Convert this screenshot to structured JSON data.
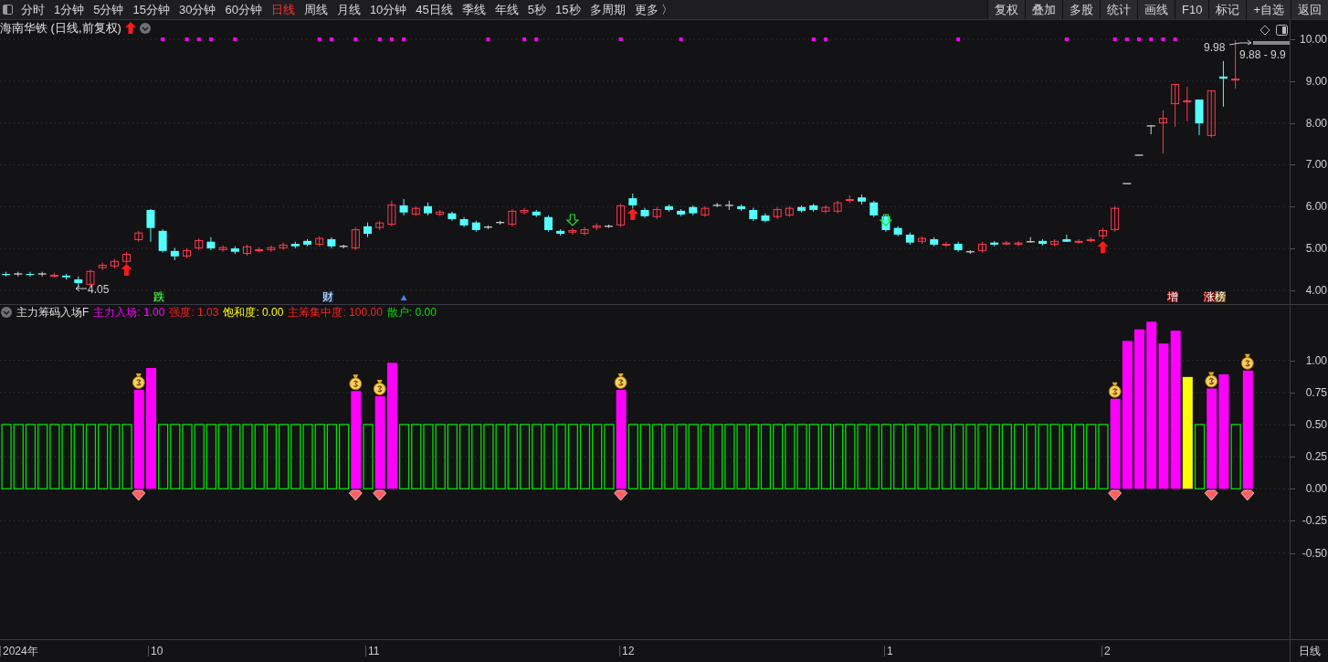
{
  "toolbar": {
    "periods": [
      {
        "label": "分时",
        "selected": false
      },
      {
        "label": "1分钟",
        "selected": false
      },
      {
        "label": "5分钟",
        "selected": false
      },
      {
        "label": "15分钟",
        "selected": false
      },
      {
        "label": "30分钟",
        "selected": false
      },
      {
        "label": "60分钟",
        "selected": false
      },
      {
        "label": "日线",
        "selected": true
      },
      {
        "label": "周线",
        "selected": false
      },
      {
        "label": "月线",
        "selected": false
      },
      {
        "label": "10分钟",
        "selected": false
      },
      {
        "label": "45日线",
        "selected": false
      },
      {
        "label": "季线",
        "selected": false
      },
      {
        "label": "年线",
        "selected": false
      },
      {
        "label": "5秒",
        "selected": false
      },
      {
        "label": "15秒",
        "selected": false
      },
      {
        "label": "多周期",
        "selected": false
      }
    ],
    "more": "更多 〉",
    "tools": [
      "复权",
      "叠加",
      "多股",
      "统计",
      "画线",
      "F10",
      "标记",
      "+自选",
      "返回"
    ]
  },
  "price_chart": {
    "title": "海南华铁 (日线,前复权)",
    "low_label": "4.05",
    "high_label": "9.98",
    "range_label": "9.88 - 9.9",
    "markers": [
      {
        "text": "跌",
        "kind": "fall"
      },
      {
        "text": "财",
        "kind": "finance"
      },
      {
        "text": "增",
        "kind": "increase"
      },
      {
        "text": "涨",
        "kind": "rise"
      },
      {
        "text": "榜",
        "kind": "list"
      }
    ],
    "chart_data": {
      "type": "candlestick",
      "grid": true,
      "ylim": [
        3.67,
        10.46
      ],
      "categories": [
        null,
        null,
        null,
        null,
        null,
        null,
        null,
        null,
        null,
        null,
        null,
        null,
        null,
        null,
        null,
        null,
        null,
        null,
        null,
        null,
        null,
        null,
        null,
        null,
        null,
        null,
        null,
        null,
        null,
        null,
        null,
        null,
        null,
        null,
        null,
        null,
        null,
        null,
        null,
        null,
        null,
        null,
        null,
        null,
        null,
        null,
        null,
        null,
        null,
        null,
        null,
        null,
        null,
        null,
        null,
        null,
        null,
        null,
        null,
        null,
        null,
        null,
        null,
        null,
        null,
        null,
        null,
        null,
        null,
        null,
        null,
        null,
        null,
        null,
        null,
        null,
        null,
        null,
        null,
        null,
        null,
        null,
        null,
        null,
        null,
        null,
        null,
        null,
        null,
        null,
        null,
        null,
        null,
        null,
        null,
        null,
        null,
        null,
        null,
        null,
        null,
        null,
        null,
        null,
        null,
        null,
        null
      ],
      "yticks": [
        {
          "value": 10,
          "label": "10.00"
        },
        {
          "value": 9,
          "label": "9.00"
        },
        {
          "value": 8,
          "label": "8.00"
        },
        {
          "value": 7,
          "label": "7.00"
        },
        {
          "value": 6,
          "label": "6.00"
        },
        {
          "value": 5,
          "label": "5.00"
        },
        {
          "value": 4,
          "label": "4.00"
        }
      ],
      "ohlc": [
        [
          4.39,
          4.44,
          4.33,
          4.37
        ],
        [
          4.39,
          4.44,
          4.33,
          4.39
        ],
        [
          4.39,
          4.44,
          4.33,
          4.37
        ],
        [
          4.39,
          4.44,
          4.33,
          4.39
        ],
        [
          4.35,
          4.42,
          4.31,
          4.37
        ],
        [
          4.35,
          4.39,
          4.26,
          4.31
        ],
        [
          4.26,
          4.33,
          4.05,
          4.17
        ],
        [
          4.13,
          4.5,
          4.09,
          4.46
        ],
        [
          4.53,
          4.66,
          4.48,
          4.61
        ],
        [
          4.57,
          4.75,
          4.52,
          4.7
        ],
        [
          4.68,
          4.92,
          4.64,
          4.87
        ],
        [
          5.2,
          5.42,
          5.16,
          5.38
        ],
        [
          5.92,
          5.94,
          5.16,
          5.49
        ],
        [
          5.42,
          5.46,
          4.9,
          4.94
        ],
        [
          4.94,
          5.01,
          4.72,
          4.81
        ],
        [
          4.81,
          5.01,
          4.77,
          4.96
        ],
        [
          5.0,
          5.24,
          4.96,
          5.2
        ],
        [
          5.16,
          5.27,
          4.96,
          5.0
        ],
        [
          4.96,
          5.07,
          4.92,
          5.03
        ],
        [
          5.0,
          5.05,
          4.87,
          4.92
        ],
        [
          4.87,
          5.09,
          4.83,
          5.05
        ],
        [
          4.94,
          5.03,
          4.9,
          4.98
        ],
        [
          4.96,
          5.07,
          4.92,
          5.03
        ],
        [
          5.0,
          5.14,
          4.96,
          5.09
        ],
        [
          5.11,
          5.16,
          5.0,
          5.05
        ],
        [
          5.18,
          5.22,
          5.05,
          5.09
        ],
        [
          5.09,
          5.29,
          5.05,
          5.25
        ],
        [
          5.22,
          5.27,
          5.0,
          5.05
        ],
        [
          5.05,
          5.09,
          5.0,
          5.05
        ],
        [
          5.0,
          5.51,
          4.96,
          5.46
        ],
        [
          5.53,
          5.62,
          5.27,
          5.35
        ],
        [
          5.49,
          5.66,
          5.44,
          5.62
        ],
        [
          5.57,
          6.14,
          5.53,
          6.05
        ],
        [
          6.03,
          6.18,
          5.79,
          5.86
        ],
        [
          5.81,
          6.01,
          5.77,
          5.97
        ],
        [
          6.01,
          6.1,
          5.79,
          5.84
        ],
        [
          5.81,
          5.92,
          5.77,
          5.88
        ],
        [
          5.84,
          5.88,
          5.66,
          5.7
        ],
        [
          5.7,
          5.75,
          5.51,
          5.55
        ],
        [
          5.62,
          5.66,
          5.4,
          5.44
        ],
        [
          5.51,
          5.55,
          5.46,
          5.51
        ],
        [
          5.62,
          5.66,
          5.57,
          5.62
        ],
        [
          5.57,
          5.94,
          5.53,
          5.9
        ],
        [
          5.86,
          5.97,
          5.81,
          5.92
        ],
        [
          5.88,
          5.92,
          5.75,
          5.79
        ],
        [
          5.75,
          5.79,
          5.4,
          5.44
        ],
        [
          5.42,
          5.46,
          5.31,
          5.35
        ],
        [
          5.38,
          5.49,
          5.33,
          5.44
        ],
        [
          5.35,
          5.51,
          5.31,
          5.46
        ],
        [
          5.49,
          5.6,
          5.44,
          5.55
        ],
        [
          5.53,
          5.57,
          5.49,
          5.53
        ],
        [
          5.55,
          6.07,
          5.51,
          6.03
        ],
        [
          6.2,
          6.31,
          5.96,
          6.03
        ],
        [
          5.92,
          5.97,
          5.73,
          5.77
        ],
        [
          5.75,
          5.99,
          5.7,
          5.94
        ],
        [
          6.01,
          6.05,
          5.88,
          5.92
        ],
        [
          5.9,
          5.94,
          5.77,
          5.81
        ],
        [
          5.99,
          6.03,
          5.79,
          5.84
        ],
        [
          5.79,
          6.01,
          5.75,
          5.97
        ],
        [
          6.03,
          6.09,
          5.99,
          6.03
        ],
        [
          6.03,
          6.14,
          5.92,
          6.03
        ],
        [
          6.01,
          6.05,
          5.9,
          5.94
        ],
        [
          5.92,
          5.97,
          5.66,
          5.7
        ],
        [
          5.79,
          5.84,
          5.62,
          5.66
        ],
        [
          5.75,
          5.99,
          5.7,
          5.94
        ],
        [
          5.79,
          6.01,
          5.75,
          5.97
        ],
        [
          5.99,
          6.03,
          5.86,
          5.9
        ],
        [
          6.03,
          6.07,
          5.88,
          5.92
        ],
        [
          5.88,
          6.03,
          5.84,
          5.99
        ],
        [
          5.88,
          6.14,
          5.84,
          6.1
        ],
        [
          6.14,
          6.27,
          6.09,
          6.18
        ],
        [
          6.22,
          6.29,
          6.05,
          6.12
        ],
        [
          6.1,
          6.14,
          5.75,
          5.79
        ],
        [
          5.77,
          5.81,
          5.4,
          5.44
        ],
        [
          5.49,
          5.53,
          5.29,
          5.33
        ],
        [
          5.33,
          5.38,
          5.09,
          5.14
        ],
        [
          5.16,
          5.29,
          5.11,
          5.25
        ],
        [
          5.22,
          5.27,
          5.05,
          5.09
        ],
        [
          5.07,
          5.16,
          5.03,
          5.11
        ],
        [
          5.11,
          5.16,
          4.92,
          4.96
        ],
        [
          4.92,
          4.96,
          4.87,
          4.92
        ],
        [
          4.94,
          5.16,
          4.9,
          5.11
        ],
        [
          5.14,
          5.18,
          5.05,
          5.09
        ],
        [
          5.11,
          5.18,
          5.07,
          5.14
        ],
        [
          5.09,
          5.18,
          5.05,
          5.14
        ],
        [
          5.16,
          5.27,
          5.14,
          5.16
        ],
        [
          5.18,
          5.22,
          5.07,
          5.11
        ],
        [
          5.09,
          5.22,
          5.05,
          5.18
        ],
        [
          5.22,
          5.33,
          5.16,
          5.16
        ],
        [
          5.16,
          5.22,
          5.11,
          5.18
        ],
        [
          5.18,
          5.27,
          5.14,
          5.22
        ],
        [
          5.29,
          5.49,
          5.22,
          5.44
        ],
        [
          5.44,
          6.01,
          5.4,
          5.97
        ],
        [
          6.55,
          6.55,
          6.55,
          6.55
        ],
        [
          7.23,
          7.23,
          7.23,
          7.23
        ],
        [
          7.93,
          7.93,
          7.73,
          7.93
        ],
        [
          7.99,
          8.3,
          7.27,
          8.12
        ],
        [
          8.45,
          8.93,
          7.91,
          8.93
        ],
        [
          8.5,
          8.87,
          8.04,
          8.54
        ],
        [
          8.56,
          8.56,
          7.71,
          7.99
        ],
        [
          7.69,
          8.78,
          7.65,
          8.78
        ],
        [
          9.11,
          9.48,
          8.39,
          9.06
        ],
        [
          9.02,
          9.98,
          8.82,
          9.06
        ],
        null,
        null,
        null,
        null
      ]
    }
  },
  "indicator": {
    "name": "主力筹码入场F",
    "legend": [
      {
        "kind": "series",
        "value": "1.00"
      },
      {
        "kind": "text",
        "label": "强度:",
        "value": "1.03",
        "color": "#ff2020"
      },
      {
        "kind": "series",
        "value": "0.00"
      },
      {
        "kind": "text",
        "label": "主筹集中度:",
        "value": "100.00",
        "color": "#ff2020"
      },
      {
        "kind": "series",
        "value": "0.00"
      }
    ],
    "chart_data": {
      "type": "bar",
      "grid": true,
      "ylim": [
        -1.17,
        1.43
      ],
      "categories": [
        null,
        null,
        null,
        null,
        null,
        null,
        null,
        null,
        null,
        null,
        null,
        null,
        null,
        null,
        null,
        null,
        null,
        null,
        null,
        null,
        null,
        null,
        null,
        null,
        null,
        null,
        null,
        null,
        null,
        null,
        null,
        null,
        null,
        null,
        null,
        null,
        null,
        null,
        null,
        null,
        null,
        null,
        null,
        null,
        null,
        null,
        null,
        null,
        null,
        null,
        null,
        null,
        null,
        null,
        null,
        null,
        null,
        null,
        null,
        null,
        null,
        null,
        null,
        null,
        null,
        null,
        null,
        null,
        null,
        null,
        null,
        null,
        null,
        null,
        null,
        null,
        null,
        null,
        null,
        null,
        null,
        null,
        null,
        null,
        null,
        null,
        null,
        null,
        null,
        null,
        null,
        null,
        null,
        null,
        null,
        null,
        null,
        null,
        null,
        null,
        null,
        null,
        null,
        null,
        null,
        null,
        null
      ],
      "yticks": [
        {
          "value": 1,
          "label": "1.00"
        },
        {
          "value": 0.75,
          "label": "0.75"
        },
        {
          "value": 0.5,
          "label": "0.50"
        },
        {
          "value": 0.25,
          "label": "0.25"
        },
        {
          "value": 0,
          "label": "0.00"
        },
        {
          "value": -0.25,
          "label": "-0.25"
        },
        {
          "value": -0.5,
          "label": "-0.50"
        }
      ],
      "series": [
        {
          "name": "散户:",
          "color": "#00e000",
          "values": [
            0.5,
            0.5,
            0.5,
            0.5,
            0.5,
            0.5,
            0.5,
            0.5,
            0.5,
            0.5,
            0.5,
            null,
            null,
            0.5,
            0.5,
            0.5,
            0.5,
            0.5,
            0.5,
            0.5,
            0.5,
            0.5,
            0.5,
            0.5,
            0.5,
            0.5,
            0.5,
            0.5,
            0.5,
            null,
            0.5,
            null,
            null,
            0.5,
            0.5,
            0.5,
            0.5,
            0.5,
            0.5,
            0.5,
            0.5,
            0.5,
            0.5,
            0.5,
            0.5,
            0.5,
            0.5,
            0.5,
            0.5,
            0.5,
            0.5,
            null,
            0.5,
            0.5,
            0.5,
            0.5,
            0.5,
            0.5,
            0.5,
            0.5,
            0.5,
            0.5,
            0.5,
            0.5,
            0.5,
            0.5,
            0.5,
            0.5,
            0.5,
            0.5,
            0.5,
            0.5,
            0.5,
            0.5,
            0.5,
            0.5,
            0.5,
            0.5,
            0.5,
            0.5,
            0.5,
            0.5,
            0.5,
            0.5,
            0.5,
            0.5,
            0.5,
            0.5,
            0.5,
            0.5,
            0.5,
            0.5,
            null,
            null,
            null,
            null,
            null,
            null,
            null,
            0.5,
            null,
            null,
            0.5,
            null,
            null,
            null,
            null
          ]
        },
        {
          "name": "主力入场:",
          "color": "#ff00ff",
          "values": [
            null,
            null,
            null,
            null,
            null,
            null,
            null,
            null,
            null,
            null,
            null,
            0.77,
            0.94,
            null,
            null,
            null,
            null,
            null,
            null,
            null,
            null,
            null,
            null,
            null,
            null,
            null,
            null,
            null,
            null,
            0.76,
            null,
            0.72,
            0.98,
            null,
            null,
            null,
            null,
            null,
            null,
            null,
            null,
            null,
            null,
            null,
            null,
            null,
            null,
            null,
            null,
            null,
            null,
            0.77,
            null,
            null,
            null,
            null,
            null,
            null,
            null,
            null,
            null,
            null,
            null,
            null,
            null,
            null,
            null,
            null,
            null,
            null,
            null,
            null,
            null,
            null,
            null,
            null,
            null,
            null,
            null,
            null,
            null,
            null,
            null,
            null,
            null,
            null,
            null,
            null,
            null,
            null,
            null,
            null,
            0.7,
            1.15,
            1.24,
            1.3,
            1.13,
            1.23,
            null,
            null,
            0.78,
            0.89,
            null,
            0.92,
            null,
            null,
            null
          ]
        },
        {
          "name": "饱和度:",
          "color": "#ffff00",
          "values": [
            null,
            null,
            null,
            null,
            null,
            null,
            null,
            null,
            null,
            null,
            null,
            null,
            null,
            null,
            null,
            null,
            null,
            null,
            null,
            null,
            null,
            null,
            null,
            null,
            null,
            null,
            null,
            null,
            null,
            null,
            null,
            null,
            null,
            null,
            null,
            null,
            null,
            null,
            null,
            null,
            null,
            null,
            null,
            null,
            null,
            null,
            null,
            null,
            null,
            null,
            null,
            null,
            null,
            null,
            null,
            null,
            null,
            null,
            null,
            null,
            null,
            null,
            null,
            null,
            null,
            null,
            null,
            null,
            null,
            null,
            null,
            null,
            null,
            null,
            null,
            null,
            null,
            null,
            null,
            null,
            null,
            null,
            null,
            null,
            null,
            null,
            null,
            null,
            null,
            null,
            null,
            null,
            null,
            null,
            null,
            null,
            null,
            null,
            0.87,
            null,
            null,
            null,
            null,
            null,
            null,
            null,
            null
          ]
        }
      ]
    }
  },
  "time_axis": {
    "labels": [
      "2024年",
      "10",
      "11",
      "12",
      "1",
      "2"
    ],
    "period": "日线"
  }
}
